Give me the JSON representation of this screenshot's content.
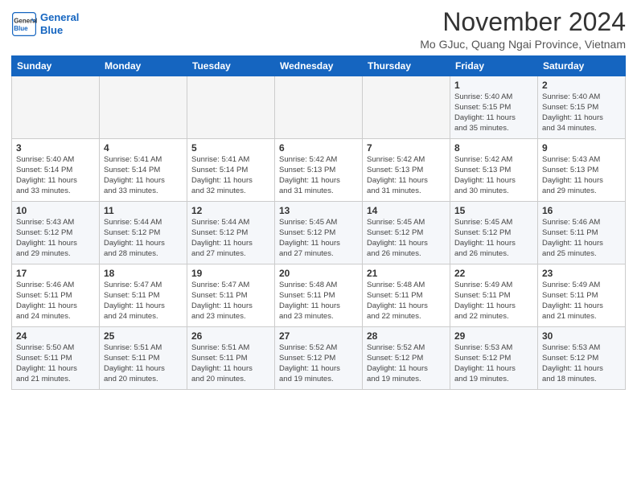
{
  "header": {
    "logo_line1": "General",
    "logo_line2": "Blue",
    "month_title": "November 2024",
    "location": "Mo GJuc, Quang Ngai Province, Vietnam"
  },
  "weekdays": [
    "Sunday",
    "Monday",
    "Tuesday",
    "Wednesday",
    "Thursday",
    "Friday",
    "Saturday"
  ],
  "weeks": [
    [
      {
        "day": "",
        "info": ""
      },
      {
        "day": "",
        "info": ""
      },
      {
        "day": "",
        "info": ""
      },
      {
        "day": "",
        "info": ""
      },
      {
        "day": "",
        "info": ""
      },
      {
        "day": "1",
        "info": "Sunrise: 5:40 AM\nSunset: 5:15 PM\nDaylight: 11 hours\nand 35 minutes."
      },
      {
        "day": "2",
        "info": "Sunrise: 5:40 AM\nSunset: 5:15 PM\nDaylight: 11 hours\nand 34 minutes."
      }
    ],
    [
      {
        "day": "3",
        "info": "Sunrise: 5:40 AM\nSunset: 5:14 PM\nDaylight: 11 hours\nand 33 minutes."
      },
      {
        "day": "4",
        "info": "Sunrise: 5:41 AM\nSunset: 5:14 PM\nDaylight: 11 hours\nand 33 minutes."
      },
      {
        "day": "5",
        "info": "Sunrise: 5:41 AM\nSunset: 5:14 PM\nDaylight: 11 hours\nand 32 minutes."
      },
      {
        "day": "6",
        "info": "Sunrise: 5:42 AM\nSunset: 5:13 PM\nDaylight: 11 hours\nand 31 minutes."
      },
      {
        "day": "7",
        "info": "Sunrise: 5:42 AM\nSunset: 5:13 PM\nDaylight: 11 hours\nand 31 minutes."
      },
      {
        "day": "8",
        "info": "Sunrise: 5:42 AM\nSunset: 5:13 PM\nDaylight: 11 hours\nand 30 minutes."
      },
      {
        "day": "9",
        "info": "Sunrise: 5:43 AM\nSunset: 5:13 PM\nDaylight: 11 hours\nand 29 minutes."
      }
    ],
    [
      {
        "day": "10",
        "info": "Sunrise: 5:43 AM\nSunset: 5:12 PM\nDaylight: 11 hours\nand 29 minutes."
      },
      {
        "day": "11",
        "info": "Sunrise: 5:44 AM\nSunset: 5:12 PM\nDaylight: 11 hours\nand 28 minutes."
      },
      {
        "day": "12",
        "info": "Sunrise: 5:44 AM\nSunset: 5:12 PM\nDaylight: 11 hours\nand 27 minutes."
      },
      {
        "day": "13",
        "info": "Sunrise: 5:45 AM\nSunset: 5:12 PM\nDaylight: 11 hours\nand 27 minutes."
      },
      {
        "day": "14",
        "info": "Sunrise: 5:45 AM\nSunset: 5:12 PM\nDaylight: 11 hours\nand 26 minutes."
      },
      {
        "day": "15",
        "info": "Sunrise: 5:45 AM\nSunset: 5:12 PM\nDaylight: 11 hours\nand 26 minutes."
      },
      {
        "day": "16",
        "info": "Sunrise: 5:46 AM\nSunset: 5:11 PM\nDaylight: 11 hours\nand 25 minutes."
      }
    ],
    [
      {
        "day": "17",
        "info": "Sunrise: 5:46 AM\nSunset: 5:11 PM\nDaylight: 11 hours\nand 24 minutes."
      },
      {
        "day": "18",
        "info": "Sunrise: 5:47 AM\nSunset: 5:11 PM\nDaylight: 11 hours\nand 24 minutes."
      },
      {
        "day": "19",
        "info": "Sunrise: 5:47 AM\nSunset: 5:11 PM\nDaylight: 11 hours\nand 23 minutes."
      },
      {
        "day": "20",
        "info": "Sunrise: 5:48 AM\nSunset: 5:11 PM\nDaylight: 11 hours\nand 23 minutes."
      },
      {
        "day": "21",
        "info": "Sunrise: 5:48 AM\nSunset: 5:11 PM\nDaylight: 11 hours\nand 22 minutes."
      },
      {
        "day": "22",
        "info": "Sunrise: 5:49 AM\nSunset: 5:11 PM\nDaylight: 11 hours\nand 22 minutes."
      },
      {
        "day": "23",
        "info": "Sunrise: 5:49 AM\nSunset: 5:11 PM\nDaylight: 11 hours\nand 21 minutes."
      }
    ],
    [
      {
        "day": "24",
        "info": "Sunrise: 5:50 AM\nSunset: 5:11 PM\nDaylight: 11 hours\nand 21 minutes."
      },
      {
        "day": "25",
        "info": "Sunrise: 5:51 AM\nSunset: 5:11 PM\nDaylight: 11 hours\nand 20 minutes."
      },
      {
        "day": "26",
        "info": "Sunrise: 5:51 AM\nSunset: 5:11 PM\nDaylight: 11 hours\nand 20 minutes."
      },
      {
        "day": "27",
        "info": "Sunrise: 5:52 AM\nSunset: 5:12 PM\nDaylight: 11 hours\nand 19 minutes."
      },
      {
        "day": "28",
        "info": "Sunrise: 5:52 AM\nSunset: 5:12 PM\nDaylight: 11 hours\nand 19 minutes."
      },
      {
        "day": "29",
        "info": "Sunrise: 5:53 AM\nSunset: 5:12 PM\nDaylight: 11 hours\nand 19 minutes."
      },
      {
        "day": "30",
        "info": "Sunrise: 5:53 AM\nSunset: 5:12 PM\nDaylight: 11 hours\nand 18 minutes."
      }
    ]
  ]
}
